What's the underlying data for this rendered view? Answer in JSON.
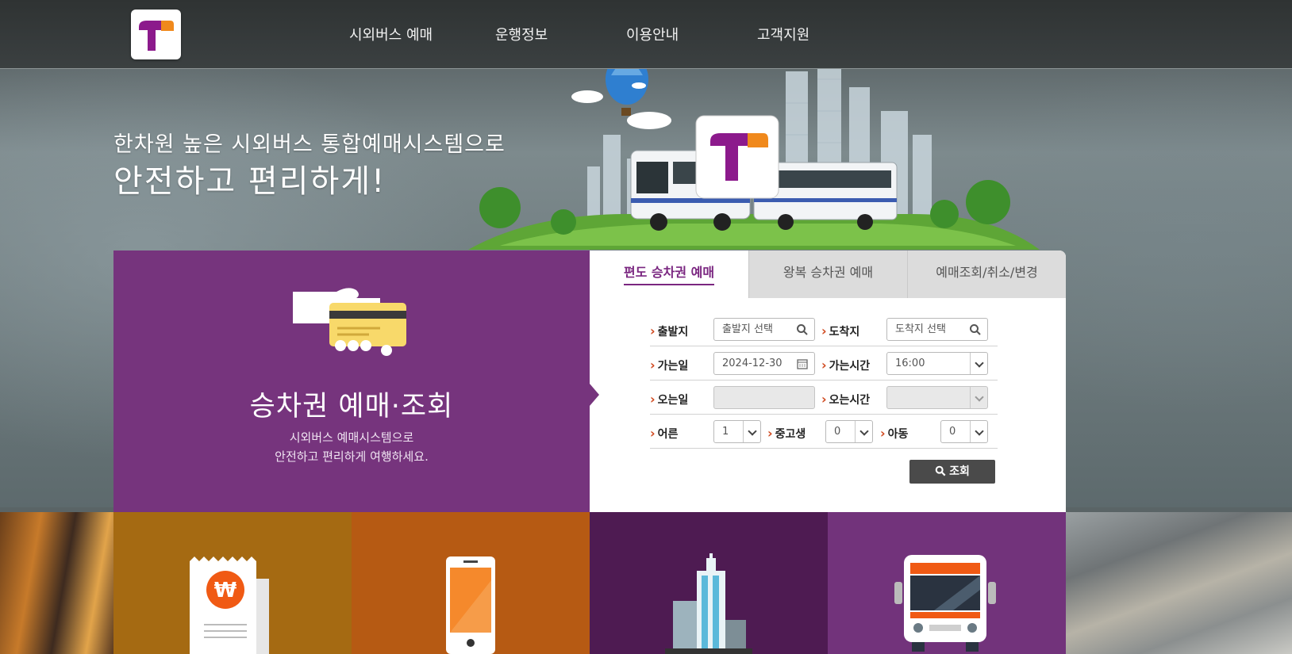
{
  "brand": {
    "logo_letter": "T",
    "logo_colors": {
      "stem": "#8c1a8c",
      "cap": "#f0891c"
    }
  },
  "nav": {
    "items": [
      {
        "label": "시외버스 예매"
      },
      {
        "label": "운행정보"
      },
      {
        "label": "이용안내"
      },
      {
        "label": "고객지원"
      }
    ]
  },
  "hero": {
    "line1": "한차원 높은 시외버스 통합예매시스템으로",
    "line2": "안전하고 편리하게!"
  },
  "panel": {
    "title": "승차권 예매·조회",
    "desc1": "시외버스 예매시스템으로",
    "desc2": "안전하고 편리하게 여행하세요."
  },
  "booking": {
    "tabs": [
      {
        "label": "편도 승차권 예매",
        "active": true
      },
      {
        "label": "왕복 승차권 예매",
        "active": false
      },
      {
        "label": "예매조회/취소/변경",
        "active": false
      }
    ],
    "departure": {
      "label": "출발지",
      "placeholder": "출발지 선택"
    },
    "arrival": {
      "label": "도착지",
      "placeholder": "도착지 선택"
    },
    "go_date": {
      "label": "가는일",
      "value": "2024-12-30"
    },
    "go_time": {
      "label": "가는시간",
      "value": "16:00"
    },
    "return_date": {
      "label": "오는일",
      "value": ""
    },
    "return_time": {
      "label": "오는시간",
      "value": ""
    },
    "adult": {
      "label": "어른",
      "value": "1"
    },
    "teen": {
      "label": "중고생",
      "value": "0"
    },
    "child": {
      "label": "아동",
      "value": "0"
    },
    "search_label": "조회"
  },
  "tiles": [
    {
      "icon": "receipt-won-icon",
      "color": "#a56a12"
    },
    {
      "icon": "smartphone-icon",
      "color": "#b65a13"
    },
    {
      "icon": "building-icon",
      "color": "#4e1b52"
    },
    {
      "icon": "bus-icon",
      "color": "#72337b"
    }
  ],
  "colors": {
    "purple": "#76347d",
    "accent": "#d0491f",
    "button": "#4a4a4a"
  }
}
